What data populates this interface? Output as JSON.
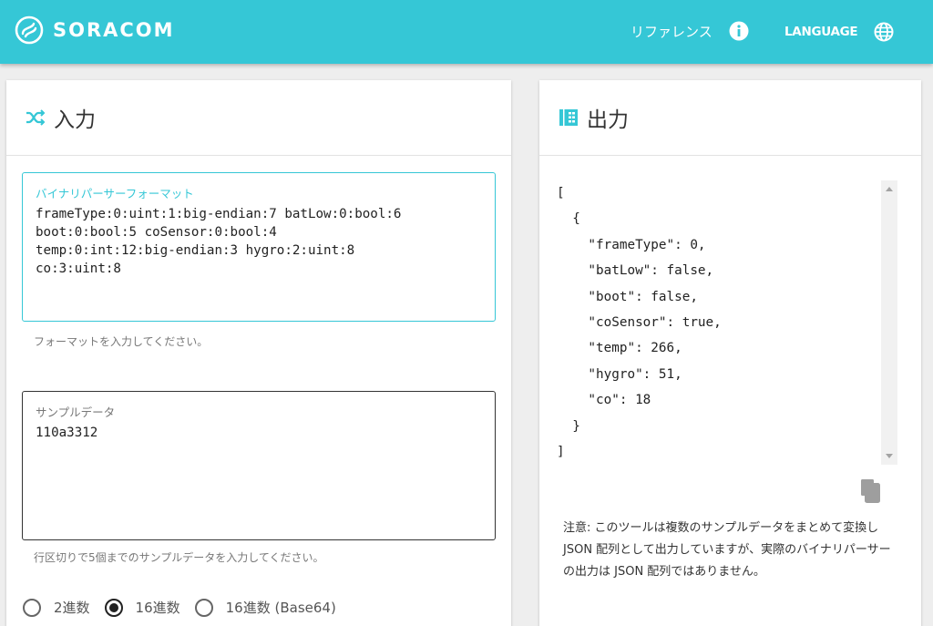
{
  "header": {
    "logo_text": "SORACOM",
    "reference_label": "リファレンス",
    "language_label": "LANGUAGE"
  },
  "input_card": {
    "title": "入力",
    "format_field": {
      "label": "バイナリパーサーフォーマット",
      "value": "frameType:0:uint:1:big-endian:7 batLow:0:bool:6\nboot:0:bool:5 coSensor:0:bool:4\ntemp:0:int:12:big-endian:3 hygro:2:uint:8\nco:3:uint:8",
      "hint": "フォーマットを入力してください。"
    },
    "sample_field": {
      "label": "サンプルデータ",
      "value": "110a3312",
      "hint": "行区切りで5個までのサンプルデータを入力してください。"
    },
    "encoding_options": [
      {
        "label": "2進数",
        "selected": false
      },
      {
        "label": "16進数",
        "selected": true
      },
      {
        "label": "16進数 (Base64)",
        "selected": false
      }
    ]
  },
  "output_card": {
    "title": "出力",
    "json_output": "[\n  {\n    \"frameType\": 0,\n    \"batLow\": false,\n    \"boot\": false,\n    \"coSensor\": true,\n    \"temp\": 266,\n    \"hygro\": 51,\n    \"co\": 18\n  }\n]",
    "note": "注意: このツールは複数のサンプルデータをまとめて変換し JSON 配列として出力していますが、実際のバイナリパーサーの出力は JSON 配列ではありません。"
  },
  "colors": {
    "brand": "#35c7d6",
    "card_bg": "#ffffff",
    "page_bg": "#eeeeee"
  },
  "icons": {
    "logo": "soracom-logo-icon",
    "reference": "info-icon",
    "language": "globe-icon",
    "input": "shuffle-icon",
    "output": "output-grid-icon",
    "copy": "copy-icon"
  }
}
